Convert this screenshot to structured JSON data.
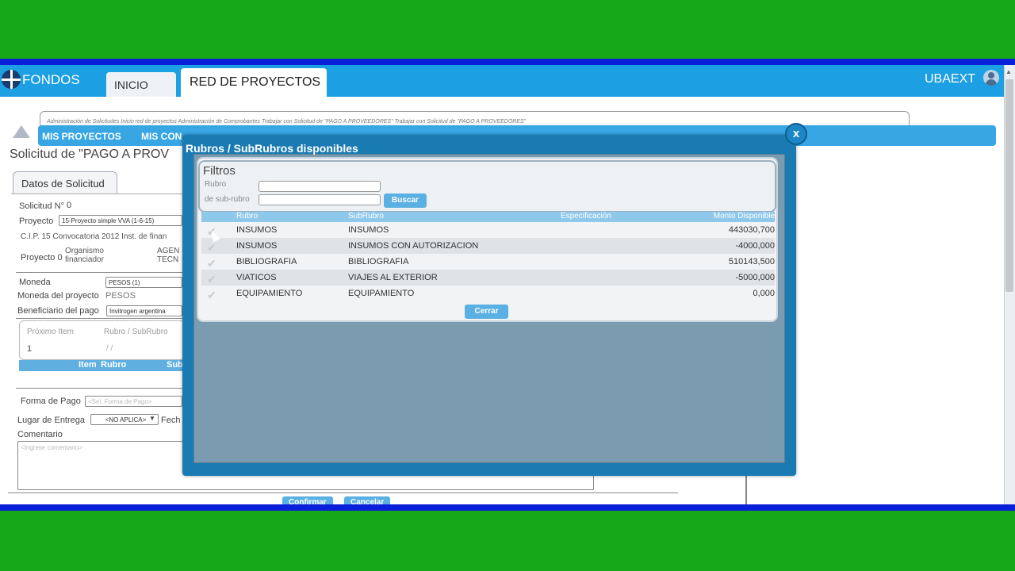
{
  "header": {
    "brand": "FONDOS",
    "tabs": [
      "INICIO",
      "RED DE PROYECTOS"
    ],
    "user": "UBAEXT"
  },
  "breadcrumb": "Administración de Solicitudes  Inicio red de proyectos  Administración de Comprobantes  Trabajar con Solicitud de \"PAGO A PROVEEDORES\"   Trabajar con Solicitud de \"PAGO A PROVEEDORES\"",
  "menu": [
    "MIS PROYECTOS",
    "MIS CON"
  ],
  "page": {
    "title": "Solicitud de \"PAGO A PROV",
    "tab": "Datos de Solicitud",
    "solicitud_label": "Solicitud N°",
    "solicitud_value": "0",
    "proyecto_label": "Proyecto",
    "proyecto_value": "15-Proyecto simple VVA (1-6-15)",
    "cip_text": "C.I.P. 15 Convocatoria 2012 Inst. de finan",
    "proyecto2_label": "Proyecto 0",
    "organismo_label": "Organismo financiador",
    "organismo_value": "AGEN TECN",
    "moneda_label": "Moneda",
    "moneda_value": "PESOS (1)",
    "moneda_proyecto_label": "Moneda del proyecto",
    "moneda_proyecto_value": "PESOS",
    "beneficiario_label": "Beneficiario del pago",
    "beneficiario_value": "Invitrogen argentina",
    "proximo_item_label": "Próximo Item",
    "proximo_item_value": "1",
    "rubro_sub_label": "Rubro / SubRubro",
    "rubro_sub_value": "/ /",
    "grid_headers": [
      "Item",
      "Rubro",
      "Sub"
    ],
    "forma_pago_label": "Forma de Pago",
    "forma_pago_placeholder": "<Sel. Forma de Pago>",
    "lugar_entrega_label": "Lugar de Entrega",
    "lugar_entrega_value": "<NO APLICA>",
    "fecha_label": "Fech",
    "comentario_label": "Comentario",
    "comentario_placeholder": "<Ingrese comentario>",
    "confirmar": "Confirmar",
    "cancelar": "Cancelar"
  },
  "modal": {
    "title": "Rubros / SubRubros disponibles",
    "close": "x",
    "filtros_title": "Filtros",
    "rubro_label": "Rubro",
    "subrubro_label": "de sub-rubro",
    "buscar": "Buscar",
    "columns": [
      "Rubro",
      "SubRubro",
      "Especificación",
      "Monto Disponible"
    ],
    "rows": [
      {
        "rubro": "INSUMOS",
        "subrubro": "INSUMOS",
        "monto": "443030,700"
      },
      {
        "rubro": "INSUMOS",
        "subrubro": "INSUMOS CON AUTORIZACION",
        "monto": "-4000,000"
      },
      {
        "rubro": "BIBLIOGRAFIA",
        "subrubro": "BIBLIOGRAFIA",
        "monto": "510143,500"
      },
      {
        "rubro": "VIATICOS",
        "subrubro": "VIAJES AL EXTERIOR",
        "monto": "-5000,000"
      },
      {
        "rubro": "EQUIPAMIENTO",
        "subrubro": "EQUIPAMIENTO",
        "monto": "0,000"
      }
    ],
    "cerrar": "Cerrar"
  },
  "colors": {
    "background": "#17a817",
    "topbar": "#1d9fe3",
    "modal_frame": "#1a7bb3",
    "accent_button": "#5ab0e2"
  }
}
